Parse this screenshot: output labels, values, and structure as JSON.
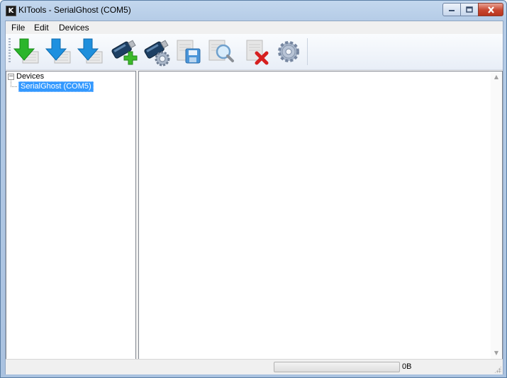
{
  "window": {
    "icon_letter": "K",
    "title": "KITools - SerialGhost (COM5)"
  },
  "menu": [
    "File",
    "Edit",
    "Devices"
  ],
  "toolbar": {
    "buttons": [
      {
        "icon": "download-green-icon"
      },
      {
        "icon": "download-blue-icon"
      },
      {
        "icon": "download-blue-alt-icon"
      },
      {
        "icon": "add-device-icon"
      },
      {
        "icon": "device-settings-icon"
      },
      {
        "icon": "save-icon"
      },
      {
        "icon": "search-icon"
      },
      {
        "icon": "delete-icon"
      },
      {
        "icon": "settings-gear-icon"
      }
    ]
  },
  "tree": {
    "root_label": "Devices",
    "root_expanded": true,
    "children": [
      "SerialGhost (COM5)"
    ],
    "selected": "SerialGhost (COM5)"
  },
  "status": {
    "progress": 0,
    "size_text": "0B"
  },
  "colors": {
    "selection": "#3399ff",
    "progress_fill": "#06b025",
    "close_button": "#c7462f"
  }
}
